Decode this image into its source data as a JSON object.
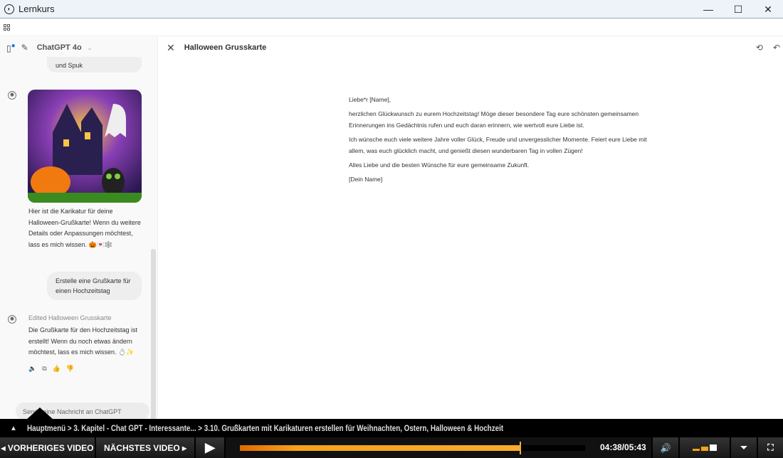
{
  "window": {
    "title": "Lernkurs",
    "minimize": "—",
    "maximize": "☐",
    "close": "✕"
  },
  "sidebar": {
    "model": "ChatGPT 4o",
    "prev_bubble": "und Spuk",
    "image_alt": "Halloween caricature",
    "reply1": "Hier ist die Karikatur für deine Halloween-Grußkarte! Wenn du weitere Details oder Anpassungen möchtest, lass es mich wissen. 🎃💌🕸️",
    "user_msg": "Erstelle eine Grußkarte für einen Hochzeitstag",
    "edited_label": "Edited Halloween Grusskarte",
    "reply2": "Die Grußkarte für den Hochzeitstag ist erstellt! Wenn du noch etwas ändern möchtest, lass es mich wissen. 💍✨",
    "input_placeholder": "Sende eine Nachricht an ChatGPT"
  },
  "document": {
    "title": "Halloween Grusskarte",
    "paragraphs": [
      "Liebe*r [Name],",
      "herzlichen Glückwunsch zu eurem Hochzeitstag! Möge dieser besondere Tag eure schönsten gemeinsamen Erinnerungen ins Gedächtnis rufen und euch daran erinnern, wie wertvoll eure Liebe ist.",
      "Ich wünsche euch viele weitere Jahre voller Glück, Freude und unvergesslicher Momente. Feiert eure Liebe mit allem, was euch glücklich macht, und genießt diesen wunderbaren Tag in vollen Zügen!",
      "Alles Liebe und die besten Wünsche für eure gemeinsame Zukunft.",
      "[Dein Name]"
    ]
  },
  "player": {
    "breadcrumb": "Hauptmenü > 3. Kapitel - Chat GPT - Interessante... > 3.10. Grußkarten mit Karikaturen erstellen für Weihnachten, Ostern, Halloween & Hochzeit",
    "prev": "◂ VORHERIGES VIDEO",
    "next": "NÄCHSTES VIDEO ▸",
    "time": "04:38/05:43",
    "progress": 0.81,
    "accent": "#f6a21a"
  }
}
